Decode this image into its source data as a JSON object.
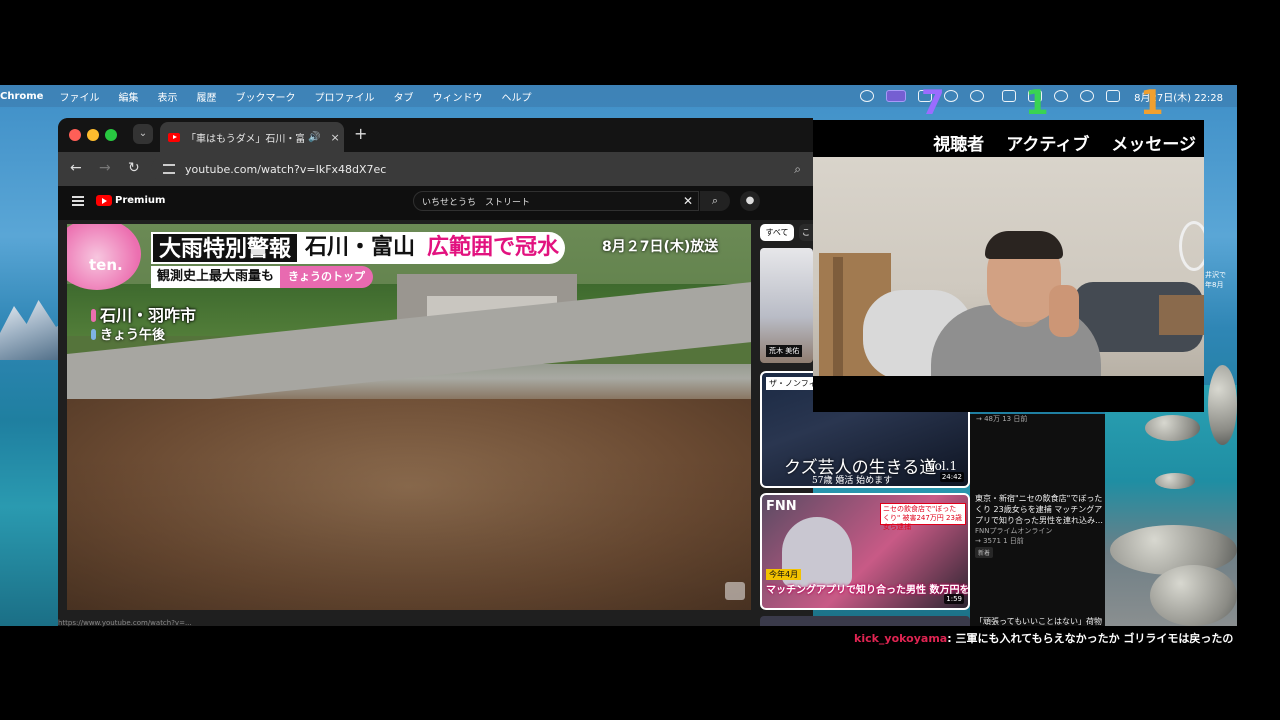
{
  "menubar": {
    "app": "Chrome",
    "items": [
      "ファイル",
      "編集",
      "表示",
      "履歴",
      "ブックマーク",
      "プロファイル",
      "タブ",
      "ウィンドウ",
      "ヘルプ"
    ],
    "clock": "8月27日(木) 22:28"
  },
  "overlay_numbers": {
    "purple": "7",
    "green": "1",
    "orange": "1"
  },
  "browser": {
    "tab_title": "「車はもうダメ」石川・富山",
    "tab_close": "×",
    "new_tab": "+",
    "url": "youtube.com/watch?v=IkFx48dX7ec"
  },
  "youtube": {
    "logo": "Premium",
    "search_value": "いちせとうち　ストリート",
    "chips": [
      "すべて",
      "こ"
    ]
  },
  "video": {
    "channel_logo": "ten.",
    "headline_black": "大雨特別警報",
    "headline_white": "石川・富山",
    "headline_pink": "広範囲で冠水",
    "subline": "観測史上最大雨量も",
    "subline_tag": "きょうのトップ",
    "airdate": "8月２7日(木)放送",
    "location": "石川・羽咋市",
    "time": "きょう午後",
    "hover_url": "https://www.youtube.com/watch?v=..."
  },
  "sidebar": {
    "thumb1_label": "荒木 美佑",
    "thumb1_meta": "→ 48万 13 日前",
    "thumb2_tag": "ザ・ノンフィクション",
    "thumb2_title": "クズ芸人の生きる道",
    "thumb2_sub": "57歳 婚活 始めます",
    "thumb2_vol": "Vol.1",
    "thumb2_duration": "24:42",
    "thumb3_logo": "FNN",
    "thumb3_box": "ニセの飲食店で\"ぼったくり\" 被害247万円 23歳女ら逮捕",
    "thumb3_yellow": "今年4月",
    "thumb3_band": "マッチングアプリで知り合った男性 数万円を",
    "thumb3_duration": "1:59",
    "video_title": "東京・新宿\"ニセの飲食店\"でぼったくり 23歳女らを逮捕 マッチングアプリで知り合った男性を連れ込み…",
    "channel": "FNNプライムオンライン",
    "meta": "→ 3571 1 日前",
    "badge": "新着",
    "next_title": "「頑張ってもいいことはない」荷物",
    "rside_text_1": "井沢で",
    "rside_text_2": "年8月"
  },
  "webcam": {
    "stats": [
      "視聴者",
      "アクティブ",
      "メッセージ"
    ]
  },
  "chat": {
    "user": "kick_yokoyama",
    "message": ": 三軍にも入れてもらえなかったか ゴリライモは戻ったの"
  },
  "colors": {
    "accent_pink": "#e2127f",
    "chat_user": "#e02452",
    "overlay_purple": "#9b6cff",
    "overlay_green": "#39d353",
    "overlay_orange": "#f0a030"
  }
}
